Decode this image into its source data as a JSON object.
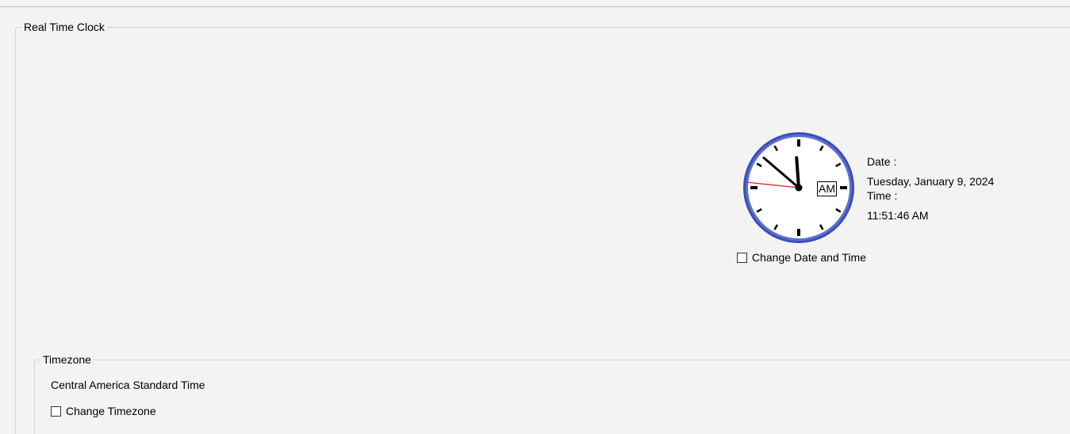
{
  "rtc": {
    "group_title": "Real Time Clock",
    "clock": {
      "hours": 11,
      "minutes": 51,
      "seconds": 46,
      "meridiem": "AM"
    },
    "date_label": "Date :",
    "date_value": "Tuesday, January 9, 2024",
    "time_label": "Time :",
    "time_value": "11:51:46 AM",
    "change_datetime_label": "Change Date and Time",
    "change_datetime_checked": false
  },
  "timezone": {
    "group_title": "Timezone",
    "current": "Central America Standard Time",
    "change_timezone_label": "Change Timezone",
    "change_timezone_checked": false
  },
  "colors": {
    "clock_rim": "#3a4fb5",
    "second_hand": "#e02020",
    "hand": "#000000"
  }
}
